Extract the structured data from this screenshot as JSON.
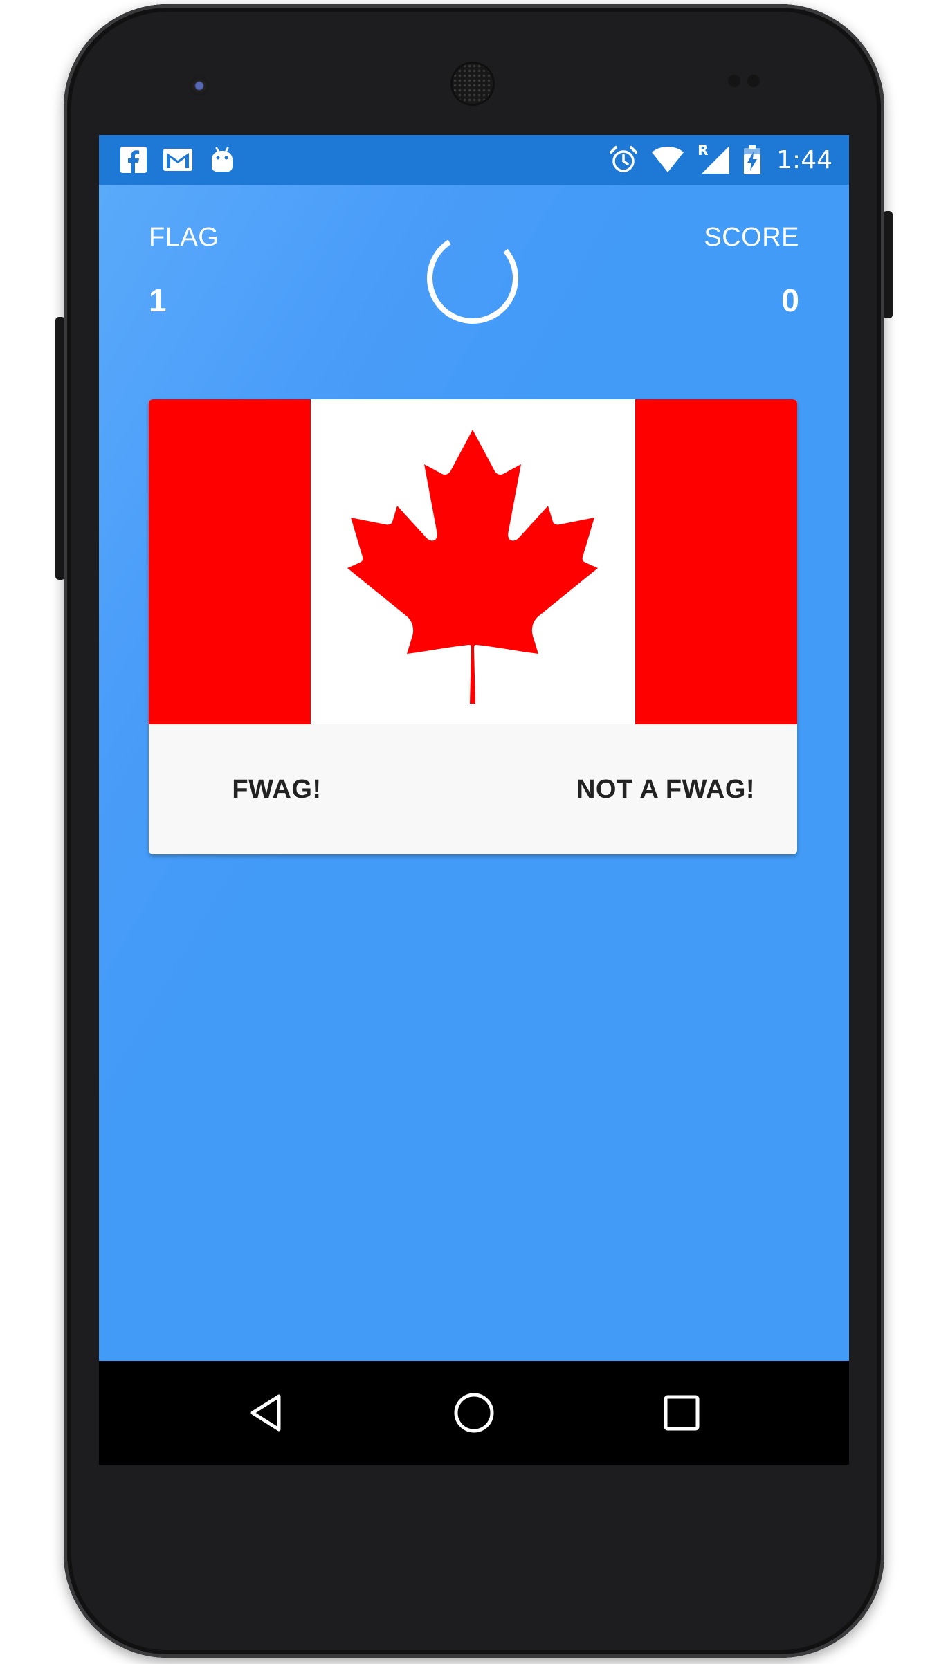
{
  "status_bar": {
    "time": "1:44",
    "roaming_label": "R",
    "left_icons": [
      "facebook-icon",
      "gmail-icon",
      "android-debug-icon"
    ],
    "right_icons": [
      "alarm-icon",
      "wifi-icon",
      "signal-icon",
      "battery-charging-icon"
    ]
  },
  "header": {
    "flag_label": "FLAG",
    "flag_value": "1",
    "score_label": "SCORE",
    "score_value": "0"
  },
  "card": {
    "flag_image": "canada-flag",
    "yes_button": "FWAG!",
    "no_button": "NOT A FWAG!"
  },
  "nav": {
    "icons": [
      "back-icon",
      "home-icon",
      "recents-icon"
    ]
  },
  "colors": {
    "status_bar": "#1e78d6",
    "app_background": "#429bf7",
    "flag_red": "#ff0000",
    "card_background": "#f8f8f8"
  }
}
